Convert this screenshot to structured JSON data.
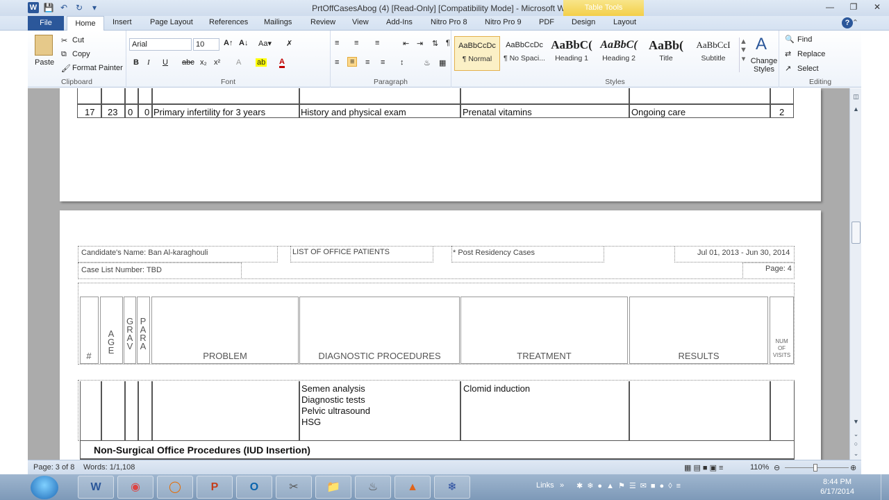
{
  "window": {
    "title": "PrtOffCasesAbog (4) [Read-Only] [Compatibility Mode]  -  Microsoft Word",
    "context_tab_group": "Table Tools",
    "app_icon": "W"
  },
  "tabs": [
    "File",
    "Home",
    "Insert",
    "Page Layout",
    "References",
    "Mailings",
    "Review",
    "View",
    "Add-Ins",
    "Nitro Pro 8",
    "Nitro Pro 9",
    "PDF",
    "Design",
    "Layout"
  ],
  "ribbon": {
    "clipboard": {
      "paste": "Paste",
      "cut": "Cut",
      "copy": "Copy",
      "format_painter": "Format Painter",
      "label": "Clipboard"
    },
    "font": {
      "name": "Arial",
      "size": "10",
      "label": "Font"
    },
    "paragraph": {
      "label": "Paragraph"
    },
    "styles": {
      "items": [
        {
          "sample": "AaBbCcDc",
          "name": "¶ Normal"
        },
        {
          "sample": "AaBbCcDc",
          "name": "¶ No Spaci..."
        },
        {
          "sample": "AaBbC(",
          "name": "Heading 1"
        },
        {
          "sample": "AaBbC(",
          "name": "Heading 2"
        },
        {
          "sample": "AaBb(",
          "name": "Title"
        },
        {
          "sample": "AaBbCcI",
          "name": "Subtitle"
        }
      ],
      "change_styles": "Change Styles",
      "label": "Styles"
    },
    "editing": {
      "find": "Find",
      "replace": "Replace",
      "select": "Select",
      "label": "Editing"
    }
  },
  "page1_row": {
    "num": "17",
    "age": "23",
    "grav": "0",
    "para": "0",
    "problem": "Primary infertility for 3 years",
    "diagnostic": "History and physical exam",
    "treatment": "Prenatal vitamins",
    "results": "Ongoing care",
    "visits": "2"
  },
  "page2": {
    "candidate": "Candidate's Name: Ban Al-karaghouli",
    "list_title": "LIST OF OFFICE PATIENTS",
    "post_residency": "* Post Residency Cases",
    "date_range": "Jul 01, 2013 - Jun 30, 2014",
    "case_list": "Case List Number: TBD",
    "page_label": "Page: 4",
    "headers": {
      "num": "#",
      "age": [
        "A",
        "G",
        "E"
      ],
      "grav": [
        "G",
        "R",
        "A",
        "V"
      ],
      "para": [
        "P",
        "A",
        "R",
        "A"
      ],
      "problem": "PROBLEM",
      "diagnostic": "DIAGNOSTIC PROCEDURES",
      "treatment": "TREATMENT",
      "results": "RESULTS",
      "visits": [
        "NUM",
        "OF",
        "VISITS"
      ]
    },
    "row_diagnostic": [
      "Semen analysis",
      "Diagnostic tests",
      "Pelvic ultrasound",
      "HSG"
    ],
    "row_treatment": "Clomid induction",
    "section_heading": "Non-Surgical Office Procedures (IUD Insertion)"
  },
  "statusbar": {
    "page": "Page: 3 of 8",
    "words": "Words: 1/1,108",
    "zoom": "110%"
  },
  "taskbar": {
    "links": "Links",
    "time": "8:44 PM",
    "date": "6/17/2014"
  }
}
